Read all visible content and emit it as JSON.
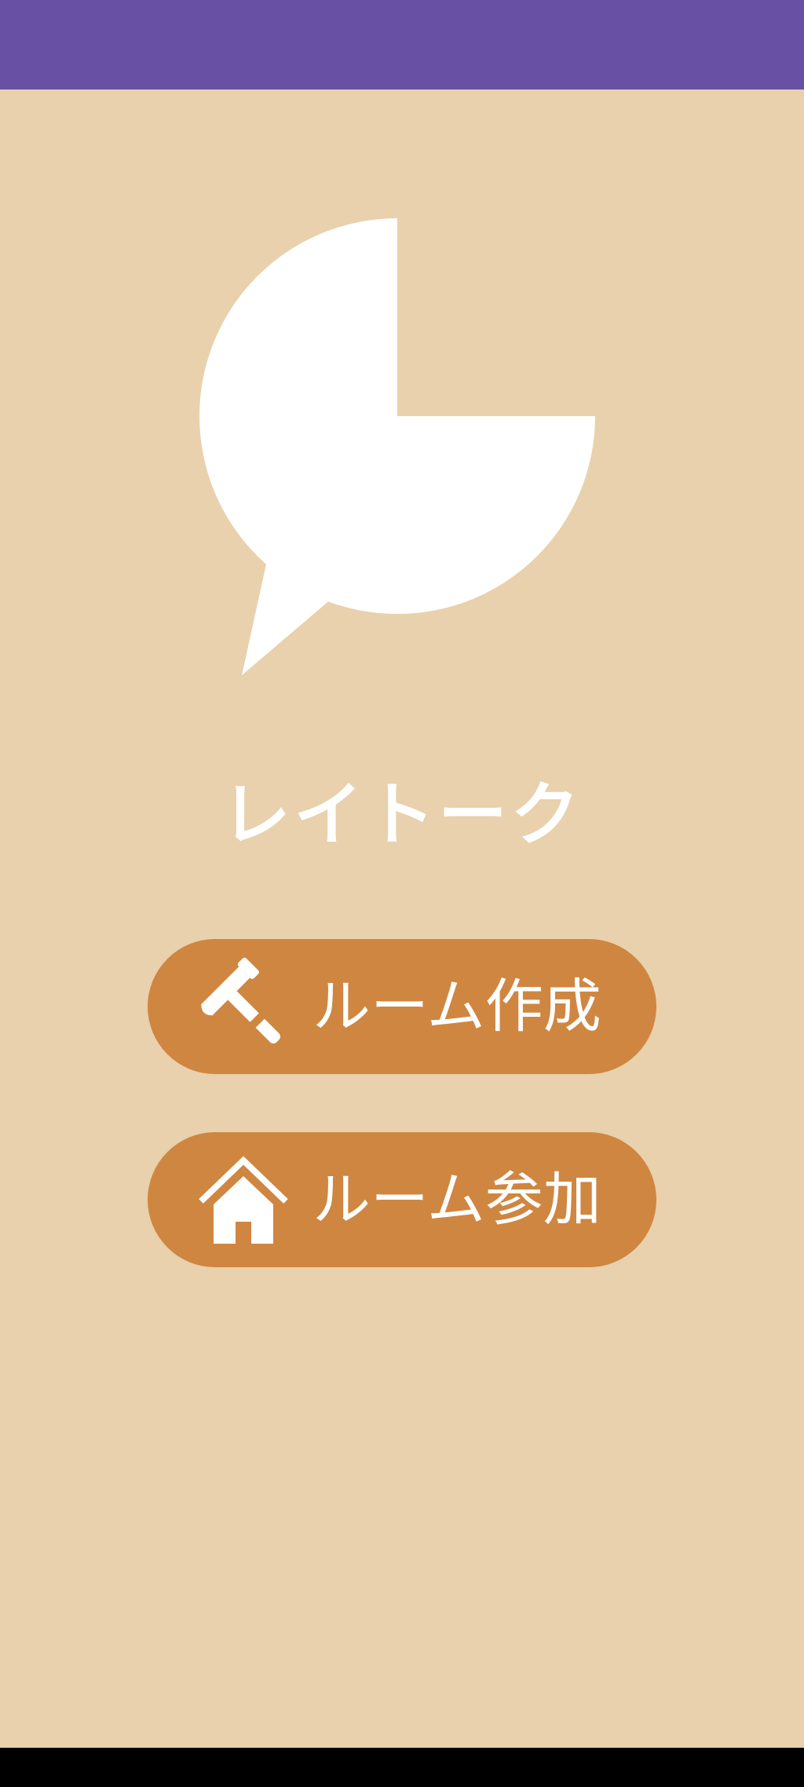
{
  "app": {
    "title": "レイトーク"
  },
  "buttons": {
    "create_room": {
      "label": "ルーム作成",
      "icon": "hammer-icon"
    },
    "join_room": {
      "label": "ルーム参加",
      "icon": "house-icon"
    }
  },
  "colors": {
    "status_bar": "#6851A4",
    "background": "#E8D1AC",
    "button": "#CF8641",
    "logo": "#FFFFFF",
    "nav_bar": "#000000"
  }
}
